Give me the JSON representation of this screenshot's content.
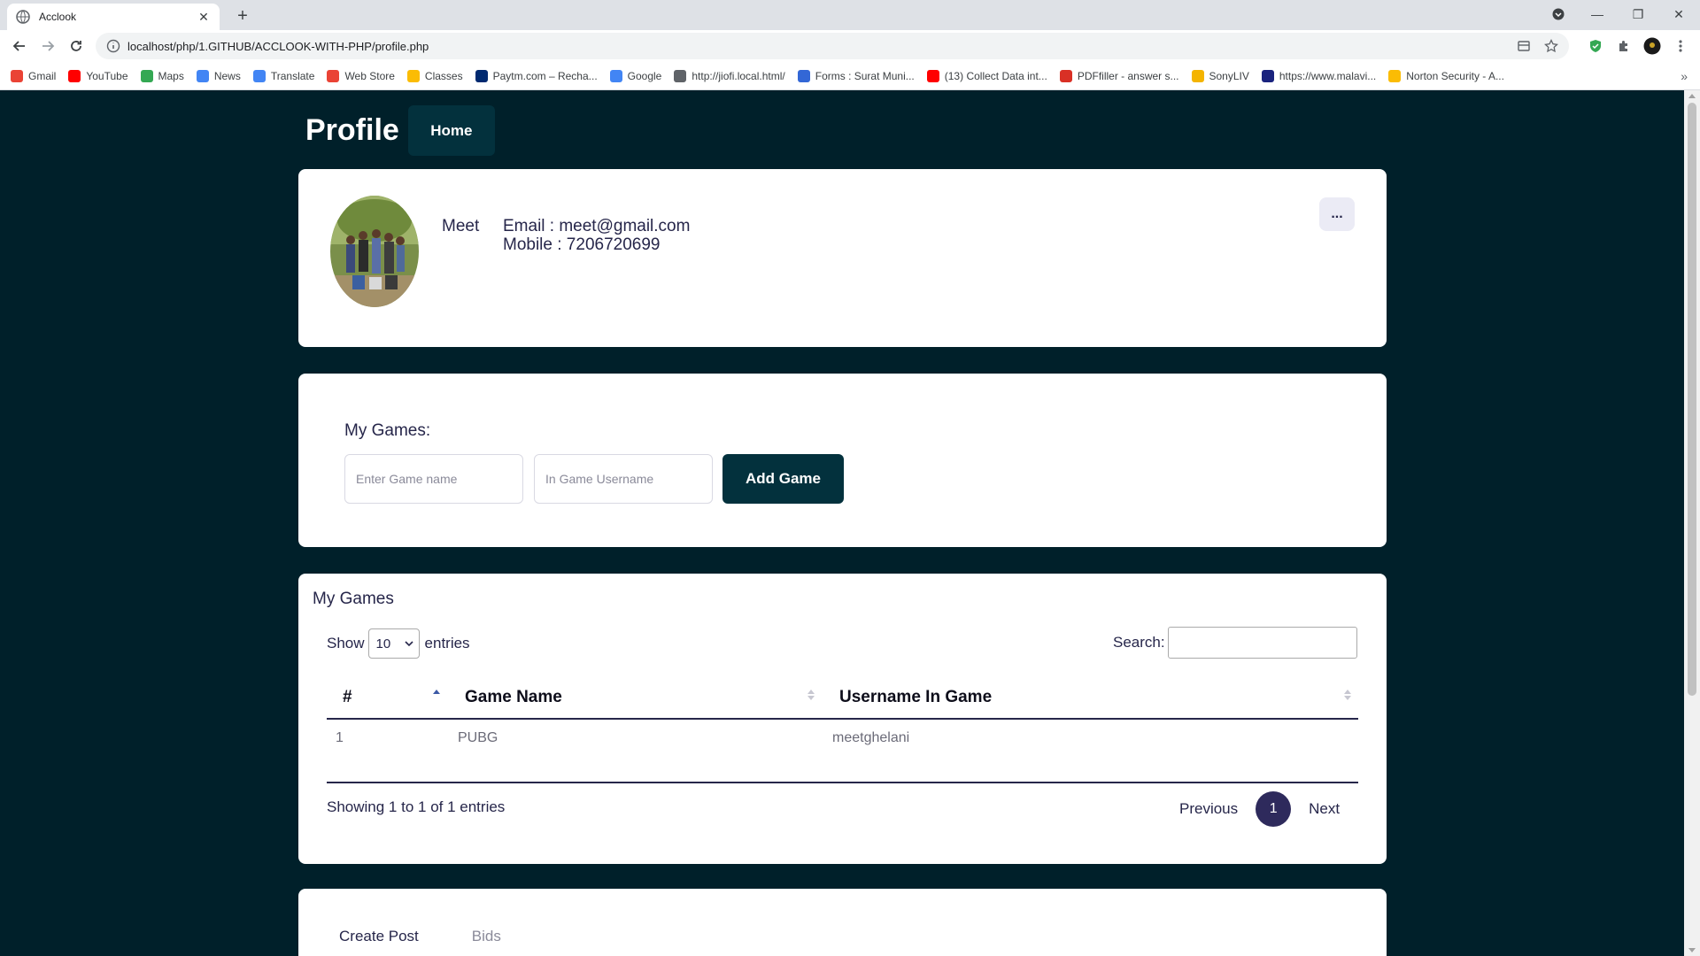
{
  "browser": {
    "tab_title": "Acclook",
    "url": "localhost/php/1.GITHUB/ACCLOOK-WITH-PHP/profile.php",
    "bookmarks": [
      {
        "label": "Gmail",
        "color": "#ea4335"
      },
      {
        "label": "YouTube",
        "color": "#ff0000"
      },
      {
        "label": "Maps",
        "color": "#34a853"
      },
      {
        "label": "News",
        "color": "#4285f4"
      },
      {
        "label": "Translate",
        "color": "#4285f4"
      },
      {
        "label": "Web Store",
        "color": "#ea4335"
      },
      {
        "label": "Classes",
        "color": "#fbbc04"
      },
      {
        "label": "Paytm.com – Recha...",
        "color": "#002970"
      },
      {
        "label": "Google",
        "color": "#4285f4"
      },
      {
        "label": "http://jiofi.local.html/",
        "color": "#5f6368"
      },
      {
        "label": "Forms : Surat Muni...",
        "color": "#3367d6"
      },
      {
        "label": "(13) Collect Data int...",
        "color": "#ff0000"
      },
      {
        "label": "PDFfiller - answer s...",
        "color": "#d93025"
      },
      {
        "label": "SonyLIV",
        "color": "#f4b400"
      },
      {
        "label": "https://www.malavi...",
        "color": "#1a237e"
      },
      {
        "label": "Norton Security - A...",
        "color": "#fbbc04"
      }
    ]
  },
  "header": {
    "title": "Profile",
    "home_label": "Home"
  },
  "profile": {
    "name": "Meet",
    "email_line": "Email : meet@gmail.com",
    "mobile_line": "Mobile : 7206720699",
    "more_label": "..."
  },
  "add_game": {
    "heading": "My Games:",
    "game_name_placeholder": "Enter Game name",
    "username_placeholder": "In Game Username",
    "button_label": "Add Game"
  },
  "games_table": {
    "title": "My Games",
    "show_label": "Show",
    "page_length": "10",
    "entries_label": "entries",
    "search_label": "Search:",
    "columns": [
      "#",
      "Game Name",
      "Username In Game"
    ],
    "rows": [
      [
        "1",
        "PUBG",
        "meetghelani"
      ]
    ],
    "info": "Showing 1 to 1 of 1 entries",
    "prev_label": "Previous",
    "current_page": "1",
    "next_label": "Next"
  },
  "post_tabs": [
    "Create Post",
    "Bids"
  ],
  "colors": {
    "page_bg": "#00202a",
    "accent": "#03313d",
    "pagination": "#2e2a5c"
  }
}
